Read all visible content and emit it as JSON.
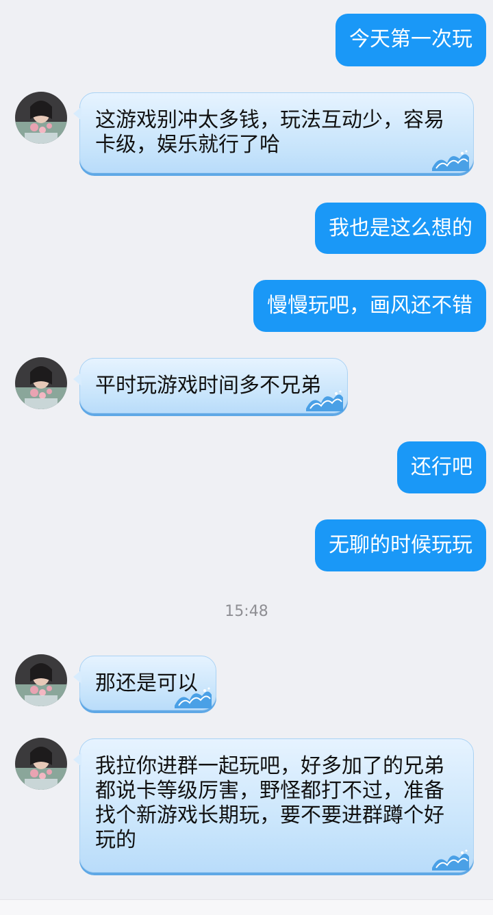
{
  "messages": [
    {
      "side": "out",
      "text": "今天第一次玩"
    },
    {
      "side": "in",
      "text": "这游戏别冲太多钱，玩法互动少，容易\n卡级，娱乐就行了哈"
    },
    {
      "side": "out",
      "text": "我也是这么想的"
    },
    {
      "side": "out",
      "text": "慢慢玩吧，画风还不错"
    },
    {
      "side": "in",
      "text": "平时玩游戏时间多不兄弟"
    },
    {
      "side": "out",
      "text": "还行吧"
    },
    {
      "side": "out",
      "text": "无聊的时候玩玩"
    },
    {
      "side": "in",
      "text": "那还是可以"
    },
    {
      "side": "in",
      "text": "我拉你进群一起玩吧，好多加了的兄弟\n都说卡等级厉害，野怪都打不过，准备\n找个新游戏长期玩，要不要进群蹲个好\n玩的"
    }
  ],
  "timestamp": "15:48",
  "colors": {
    "outgoing_bubble": "#1a98f7",
    "incoming_bubble": "#c7e4fb",
    "background": "#eff0f4"
  },
  "icons": {
    "avatar": "contact-avatar",
    "bubble_decoration": "wave-icon"
  }
}
